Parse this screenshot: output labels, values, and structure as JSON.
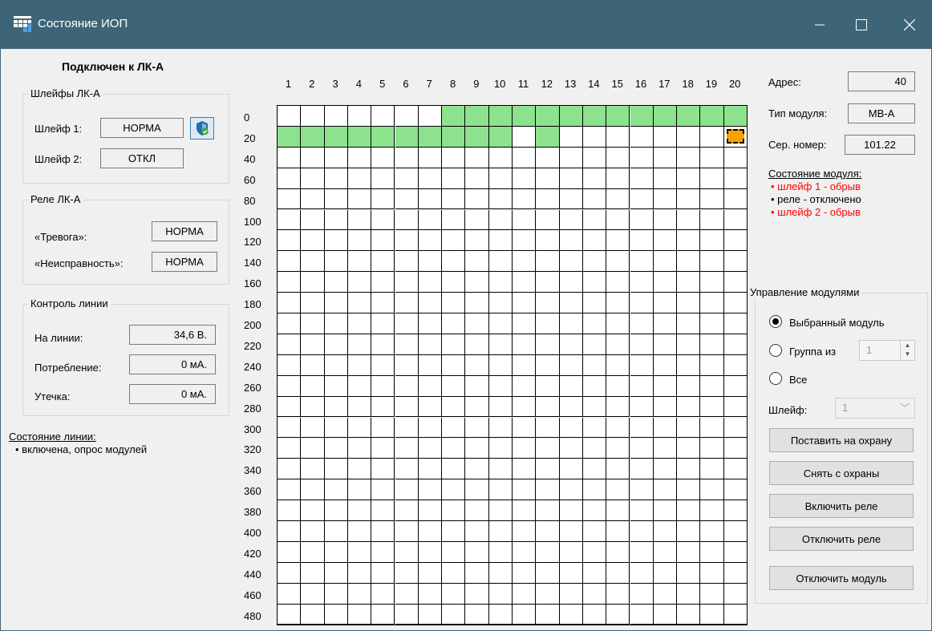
{
  "window": {
    "title": "Состояние ИОП"
  },
  "left": {
    "connection": "Подключен к ЛК-А",
    "loops_group": {
      "title": "Шлейфы ЛК-А",
      "loop1_label": "Шлейф 1:",
      "loop1_value": "НОРМА",
      "loop2_label": "Шлейф 2:",
      "loop2_value": "ОТКЛ"
    },
    "relay_group": {
      "title": "Реле ЛК-А",
      "alarm_label": "«Тревога»:",
      "alarm_value": "НОРМА",
      "fault_label": "«Неисправность»:",
      "fault_value": "НОРМА"
    },
    "line_group": {
      "title": "Контроль линии",
      "voltage_label": "На линии:",
      "voltage_value": "34,6 В.",
      "consumption_label": "Потребление:",
      "consumption_value": "0 мА.",
      "leak_label": "Утечка:",
      "leak_value": "0 мА."
    },
    "line_status": {
      "title": "Состояние линии:",
      "items": [
        "• включена, опрос модулей"
      ]
    }
  },
  "grid": {
    "col_headers": [
      "1",
      "2",
      "3",
      "4",
      "5",
      "6",
      "7",
      "8",
      "9",
      "10",
      "11",
      "12",
      "13",
      "14",
      "15",
      "16",
      "17",
      "18",
      "19",
      "20"
    ],
    "row_headers": [
      "0",
      "20",
      "40",
      "60",
      "80",
      "100",
      "120",
      "140",
      "160",
      "180",
      "200",
      "220",
      "240",
      "260",
      "280",
      "300",
      "320",
      "340",
      "360",
      "380",
      "400",
      "420",
      "440",
      "460",
      "480"
    ],
    "active_cells": {
      "row0": [
        8,
        9,
        10,
        11,
        12,
        13,
        14,
        15,
        16,
        17,
        18,
        19,
        20
      ],
      "row1": [
        1,
        2,
        3,
        4,
        5,
        6,
        7,
        8,
        9,
        10,
        12
      ]
    },
    "selected_cell": {
      "row": 1,
      "col": 20
    },
    "colors": {
      "active": "#8de28d",
      "selected": "#f5a300"
    }
  },
  "right": {
    "address_label": "Адрес:",
    "address_value": "40",
    "type_label": "Тип модуля:",
    "type_value": "МВ-А",
    "serial_label": "Сер. номер:",
    "serial_value": "101.22",
    "module_status": {
      "title": "Состояние модуля:",
      "line1": "• шлейф 1 - обрыв",
      "line2": "• реле - отключено",
      "line3": "• шлейф 2 - обрыв"
    },
    "control": {
      "title": "Управление модулями",
      "radio_selected": "Выбранный модуль",
      "radio_group": "Группа из",
      "group_count": "1",
      "radio_all": "Все",
      "loop_label": "Шлейф:",
      "loop_value": "1",
      "btn_arm": "Поставить на охрану",
      "btn_disarm": "Снять с охраны",
      "btn_relay_on": "Включить реле",
      "btn_relay_off": "Отключить реле",
      "btn_disable": "Отключить модуль"
    }
  }
}
